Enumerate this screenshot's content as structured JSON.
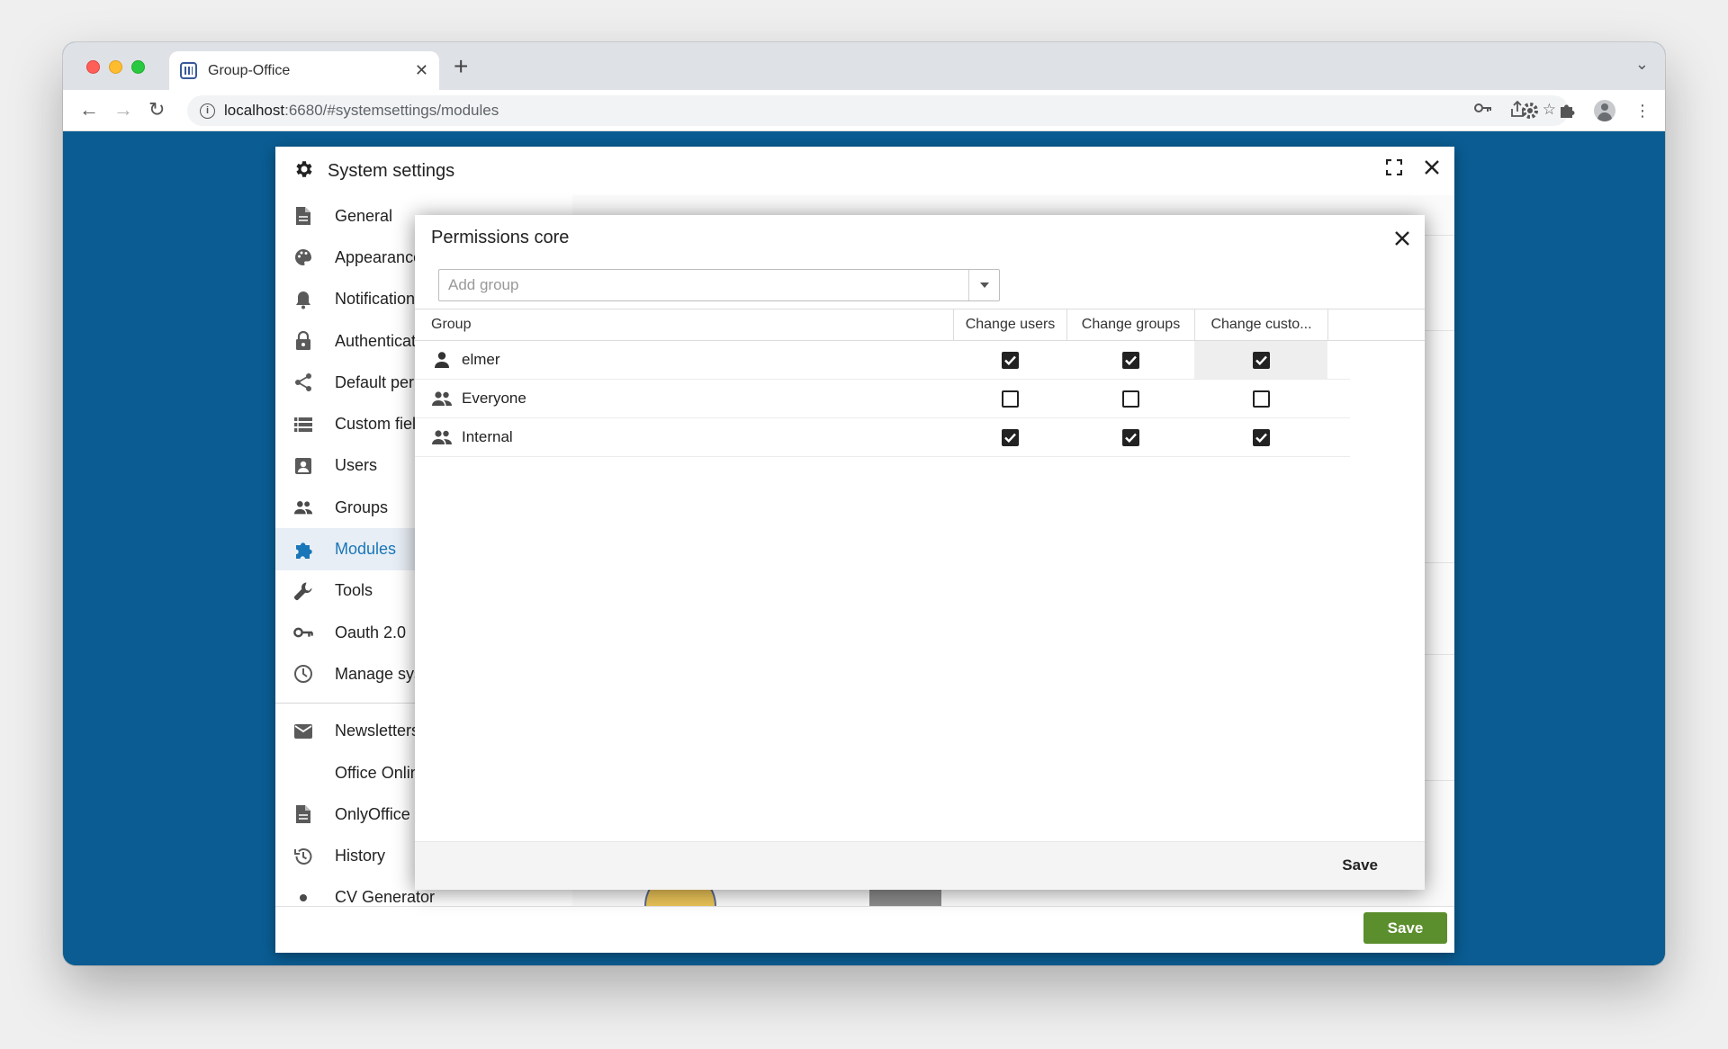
{
  "browser": {
    "tab_title": "Group-Office",
    "url_host": "localhost",
    "url_path": ":6680/#systemsettings/modules"
  },
  "settings": {
    "title": "System settings",
    "save_label": "Save",
    "nav": [
      {
        "label": "General",
        "icon": "document-icon"
      },
      {
        "label": "Appearance",
        "icon": "palette-icon"
      },
      {
        "label": "Notifications",
        "icon": "bell-icon"
      },
      {
        "label": "Authentication",
        "icon": "lock-icon"
      },
      {
        "label": "Default permissions",
        "icon": "share-icon"
      },
      {
        "label": "Custom fields",
        "icon": "list-icon"
      },
      {
        "label": "Users",
        "icon": "user-card-icon"
      },
      {
        "label": "Groups",
        "icon": "group-icon"
      },
      {
        "label": "Modules",
        "icon": "puzzle-icon",
        "active": true
      },
      {
        "label": "Tools",
        "icon": "wrench-icon"
      },
      {
        "label": "Oauth 2.0",
        "icon": "key-icon"
      },
      {
        "label": "Manage system",
        "icon": "clock-icon"
      }
    ],
    "nav_extra": [
      {
        "label": "Newsletters",
        "icon": "envelope-icon"
      },
      {
        "label": "Office Online",
        "icon": ""
      },
      {
        "label": "OnlyOffice",
        "icon": "document-icon"
      },
      {
        "label": "History",
        "icon": "history-icon"
      },
      {
        "label": "CV Generator",
        "icon": "dot-icon"
      }
    ]
  },
  "dialog": {
    "title": "Permissions core",
    "add_group_placeholder": "Add group",
    "columns": [
      "Group",
      "Change users",
      "Change groups",
      "Change custo..."
    ],
    "rows": [
      {
        "name": "elmer",
        "icon": "user-icon",
        "change_users": true,
        "change_groups": true,
        "change_custom": true
      },
      {
        "name": "Everyone",
        "icon": "group-icon",
        "change_users": false,
        "change_groups": false,
        "change_custom": false
      },
      {
        "name": "Internal",
        "icon": "group-icon",
        "change_users": true,
        "change_groups": true,
        "change_custom": true
      }
    ],
    "save_label": "Save"
  },
  "colors": {
    "desktop_blue": "#0a5c92",
    "accent_blue": "#1976b8",
    "save_green": "#5b8e2c"
  }
}
